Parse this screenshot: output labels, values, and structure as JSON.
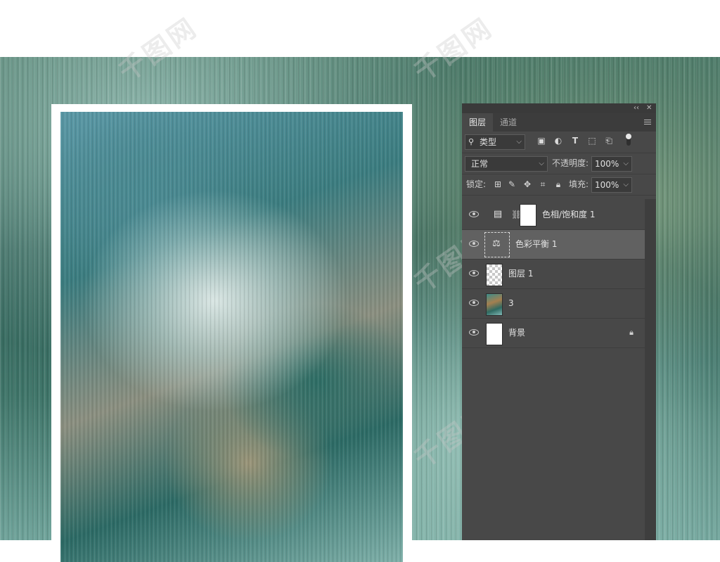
{
  "watermarks": [
    "千图网",
    "千图网",
    "千图网",
    "千图网",
    "千图网",
    "千图网"
  ],
  "panel": {
    "tabs": [
      {
        "label": "图层",
        "active": true
      },
      {
        "label": "通道",
        "active": false
      }
    ],
    "collapse_glyph": "‹‹",
    "close_glyph": "✕",
    "filter": {
      "kind_label": "类型",
      "icons": [
        "image-filter-icon",
        "adjustment-filter-icon",
        "type-filter-icon",
        "shape-filter-icon",
        "smart-object-filter-icon"
      ]
    },
    "blend_mode": "正常",
    "opacity_label": "不透明度:",
    "opacity_value": "100%",
    "lock_label": "锁定:",
    "fill_label": "填充:",
    "fill_value": "100%",
    "layers": [
      {
        "name": "色相/饱和度 1",
        "type": "adjustment-hue-saturation",
        "selected": false
      },
      {
        "name": "色彩平衡 1",
        "type": "adjustment-color-balance",
        "selected": true
      },
      {
        "name": "图层 1",
        "type": "transparent",
        "selected": false
      },
      {
        "name": "3",
        "type": "image",
        "selected": false
      },
      {
        "name": "背景",
        "type": "background",
        "selected": false,
        "locked": true
      }
    ]
  }
}
